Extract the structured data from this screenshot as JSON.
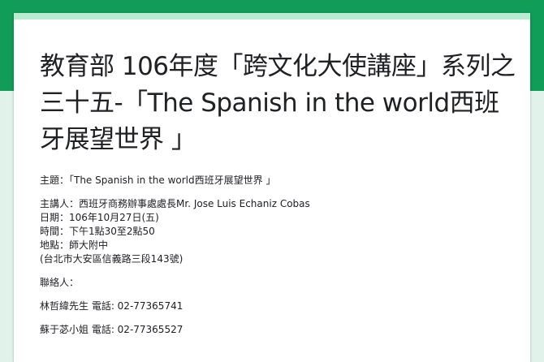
{
  "form": {
    "title": "教育部 106年度「跨文化大使講座」系列之三十五-「The Spanish in the world西班牙展望世界 」",
    "description": {
      "topic": "主題：「The Spanish in the world西班牙展望世界 」",
      "speaker": "主講人：西班牙商務辦事處處長Mr. Jose Luis Echaniz Cobas",
      "date": "日期：106年10月27日(五)",
      "time": "時間：下午1點30至2點50",
      "location": "地點：師大附中",
      "address": "(台北市大安區信義路三段143號)",
      "contact_label": "聯絡人：",
      "contact_1": "林哲緯先生 電話: 02-77365741",
      "contact_2": "蘇于苾小姐 電話: 02-77365527"
    }
  },
  "colors": {
    "header": "#0f9d58",
    "background": "#e0f2e9",
    "card_accent": "#b9ebd1"
  }
}
